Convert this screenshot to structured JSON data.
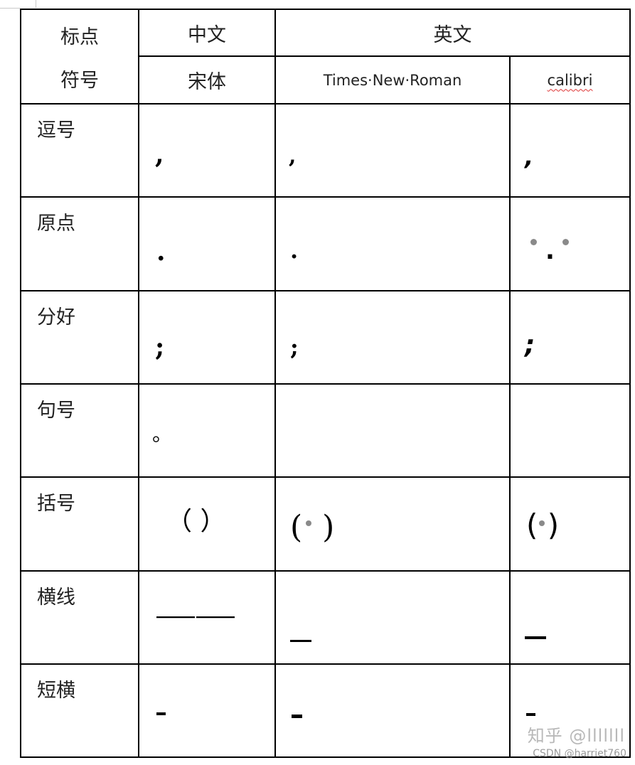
{
  "table": {
    "header": {
      "col1": "标点\n符号",
      "col1_line1": "标点",
      "col1_line2": "符号",
      "chinese_group": "中文",
      "english_group": "英文",
      "font_songti": "宋体",
      "font_times": "Times·New·Roman",
      "font_calibri": "calibri"
    },
    "rows": [
      {
        "label": "逗号",
        "songti": ",",
        "times": ",",
        "calibri": ","
      },
      {
        "label": "原点",
        "songti": ".",
        "times": ".",
        "calibri": "."
      },
      {
        "label": "分好",
        "songti": ";",
        "times": ";",
        "calibri": ";"
      },
      {
        "label": "句号",
        "songti": "。",
        "times": "",
        "calibri": ""
      },
      {
        "label": "括号",
        "songti": "（ ）",
        "times": "( )",
        "calibri": "( )"
      },
      {
        "label": "横线",
        "songti": "——",
        "times": "_",
        "calibri": "—"
      },
      {
        "label": "短横",
        "songti": "-",
        "times": "-",
        "calibri": "-"
      }
    ]
  },
  "watermark": {
    "zhihu": "知乎 @lllllll",
    "csdn": "CSDN @harriet760"
  }
}
